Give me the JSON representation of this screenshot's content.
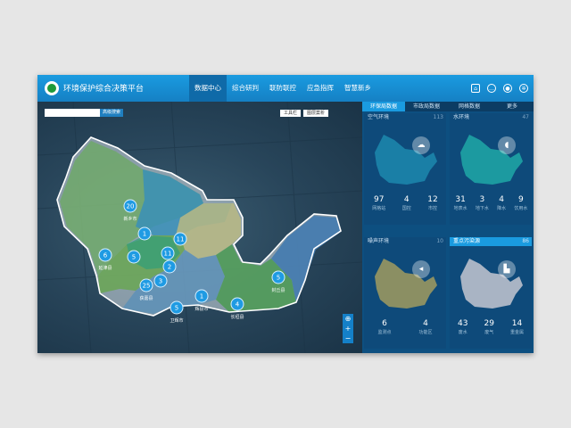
{
  "app": {
    "title": "环境保护综合决策平台"
  },
  "nav": {
    "items": [
      "数据中心",
      "综合研判",
      "联防联控",
      "应急指挥",
      "智慧新乡"
    ],
    "active": 0
  },
  "toolbar_icons": [
    "home-icon",
    "message-icon",
    "user-icon",
    "settings-icon"
  ],
  "map": {
    "search_button": "高级搜索",
    "tools": [
      "工具栏",
      "图层案析"
    ],
    "zoom": [
      "+",
      "−"
    ],
    "markers": [
      {
        "count": "20",
        "name": "新乡市"
      },
      {
        "count": "1",
        "name": ""
      },
      {
        "count": "11",
        "name": ""
      },
      {
        "count": "6",
        "name": "延津县"
      },
      {
        "count": "5",
        "name": ""
      },
      {
        "count": "11",
        "name": ""
      },
      {
        "count": "2",
        "name": ""
      },
      {
        "count": "3",
        "name": ""
      },
      {
        "count": "25",
        "name": "获嘉县"
      },
      {
        "count": "1",
        "name": "辉县市"
      },
      {
        "count": "5",
        "name": "封丘县"
      },
      {
        "count": "4",
        "name": "长垣县"
      },
      {
        "count": "5",
        "name": "卫辉市"
      }
    ]
  },
  "right_tabs": [
    "环保局数据",
    "市政局数据",
    "网格数据",
    "更多"
  ],
  "cards": [
    {
      "title": "空气环境",
      "count": "113",
      "icon": "cloud-icon",
      "color": "#1a7fa6",
      "stats": [
        {
          "v": "97",
          "l": "网格站"
        },
        {
          "v": "4",
          "l": "国控"
        },
        {
          "v": "12",
          "l": "市控"
        }
      ]
    },
    {
      "title": "水环境",
      "count": "47",
      "icon": "water-drop-icon",
      "color": "#1c9aa0",
      "stats": [
        {
          "v": "31",
          "l": "地表水"
        },
        {
          "v": "3",
          "l": "地下水"
        },
        {
          "v": "4",
          "l": "降水"
        },
        {
          "v": "9",
          "l": "饮用水"
        }
      ]
    },
    {
      "title": "噪声环境",
      "count": "10",
      "icon": "speaker-icon",
      "color": "#8b8f63",
      "stats": [
        {
          "v": "6",
          "l": "监测点"
        },
        {
          "v": "4",
          "l": "功能区"
        }
      ]
    },
    {
      "title": "重点污染源",
      "count": "86",
      "icon": "factory-icon",
      "color": "#a9b4c4",
      "stats": [
        {
          "v": "43",
          "l": "废水"
        },
        {
          "v": "29",
          "l": "废气"
        },
        {
          "v": "14",
          "l": "重金属"
        }
      ]
    }
  ]
}
